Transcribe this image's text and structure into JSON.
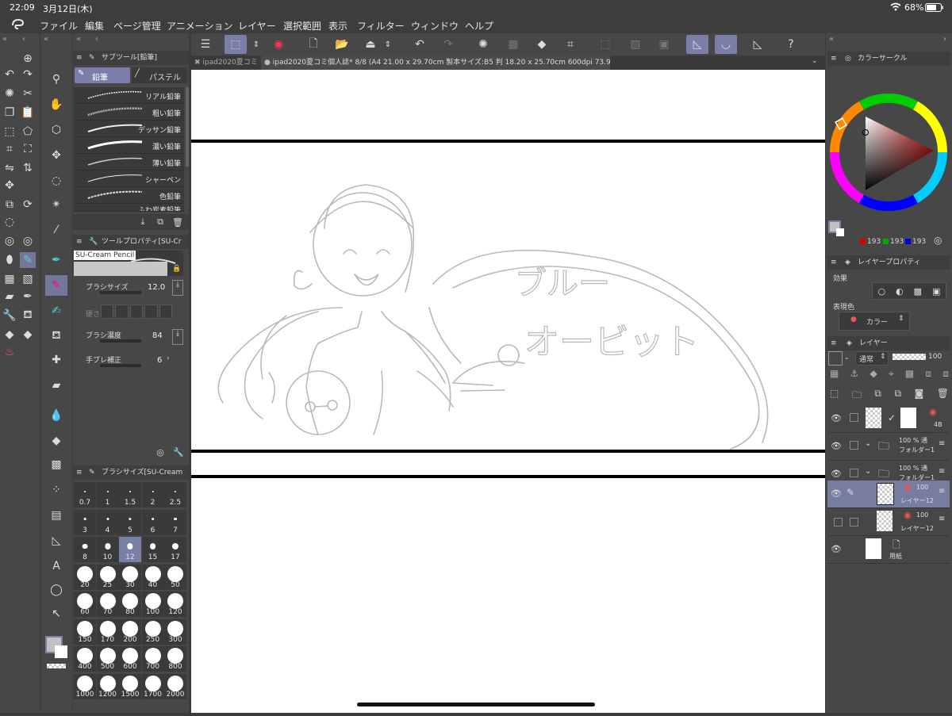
{
  "status": {
    "time": "22:09",
    "date": "3月12日(木)",
    "battery": "68%"
  },
  "menu": [
    "ファイル",
    "編集",
    "ページ管理",
    "アニメーション",
    "レイヤー",
    "選択範囲",
    "表示",
    "フィルター",
    "ウィンドウ",
    "ヘルプ"
  ],
  "tabs": [
    {
      "label": "ipad2020夏コミ",
      "active": false
    },
    {
      "label": "ipad2020夏コミ個人誌* 8/8 (A4 21.00 x 29.70cm 製本サイズ:B5 判 18.20 x 25.70cm 600dpi 73.9%)",
      "active": true
    }
  ],
  "subtool": {
    "title": "サブツール[鉛筆]",
    "tab_pencil": "鉛筆",
    "tab_pastel": "パステル",
    "brushes": [
      "リアル鉛筆",
      "粗い鉛筆",
      "デッサン鉛筆",
      "濃い鉛筆",
      "薄い鉛筆",
      "シャーペン",
      "色鉛筆"
    ],
    "partial_brush": "ふわ炭素鉛筆"
  },
  "toolprop": {
    "title": "ツールプロパティ[SU-Cr",
    "brush_name": "SU-Cream Pencil",
    "size_label": "ブラシサイズ",
    "size_value": "12.0",
    "hardness_label": "硬さ",
    "density_label": "ブラシ濃度",
    "density_value": "84",
    "stabilize_label": "手ブレ補正",
    "stabilize_value": "6"
  },
  "brushsize": {
    "title": "ブラシサイズ[SU-Cream",
    "sizes": [
      "0.7",
      "1",
      "1.5",
      "2",
      "2.5",
      "3",
      "4",
      "5",
      "6",
      "7",
      "8",
      "10",
      "12",
      "15",
      "17",
      "20",
      "25",
      "30",
      "40",
      "50",
      "60",
      "70",
      "80",
      "100",
      "120",
      "150",
      "170",
      "200",
      "250",
      "300",
      "400",
      "500",
      "600",
      "700",
      "800",
      "1000",
      "1200",
      "1500",
      "1700",
      "2000"
    ],
    "selected": "12"
  },
  "colorcircle": {
    "title": "カラーサークル",
    "r": "193",
    "g": "193",
    "b": "193"
  },
  "layerprop": {
    "title": "レイヤープロパティ",
    "effect_label": "効果",
    "express_label": "表現色",
    "express_value": "カラー"
  },
  "layers": {
    "title": "レイヤー",
    "blend": "通常",
    "opacity": "100",
    "items": [
      {
        "name": "4B",
        "opacity": "",
        "active": false
      },
      {
        "name": "フォルダー1",
        "opacity": "100 % 通",
        "active": false
      },
      {
        "name": "フォルダー1",
        "opacity": "100 % 通",
        "active": false
      },
      {
        "name": "レイヤー12",
        "opacity": "100",
        "active": true
      },
      {
        "name": "レイヤー12",
        "opacity": "100",
        "active": false
      },
      {
        "name": "用紙",
        "opacity": "",
        "active": false
      }
    ]
  },
  "sketch_text": {
    "line1": "ブルー",
    "line2": "オービット"
  },
  "colors": {
    "accent": "#767d9e",
    "panel": "#474747",
    "canvas": "#ffffff"
  }
}
